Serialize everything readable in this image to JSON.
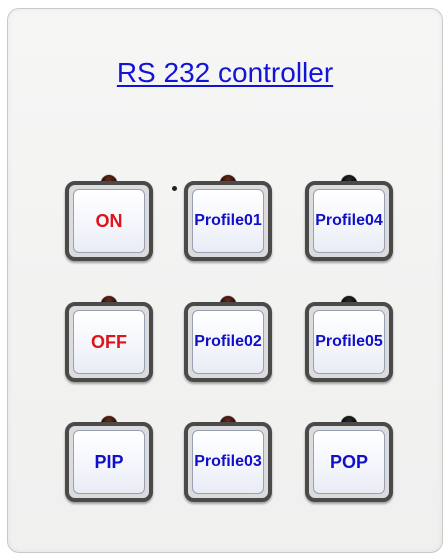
{
  "panel": {
    "title": "RS 232 controller"
  },
  "buttons": {
    "on": {
      "label": "ON"
    },
    "off": {
      "label": "OFF"
    },
    "pip": {
      "label": "PIP"
    },
    "pop": {
      "label": "POP"
    },
    "profile_01": {
      "line1": "Profile",
      "line2": "01"
    },
    "profile_02": {
      "line1": "Profile",
      "line2": "02"
    },
    "profile_03": {
      "line1": "Profile",
      "line2": "03"
    },
    "profile_04": {
      "line1": "Profile",
      "line2": "04"
    },
    "profile_05": {
      "line1": "Profile",
      "line2": "05"
    }
  },
  "colors": {
    "title": "#1414d8",
    "power_text": "#e0121a",
    "button_text": "#1010c8",
    "led_red": "#6a2a1a",
    "led_off": "#2a2a2a"
  }
}
